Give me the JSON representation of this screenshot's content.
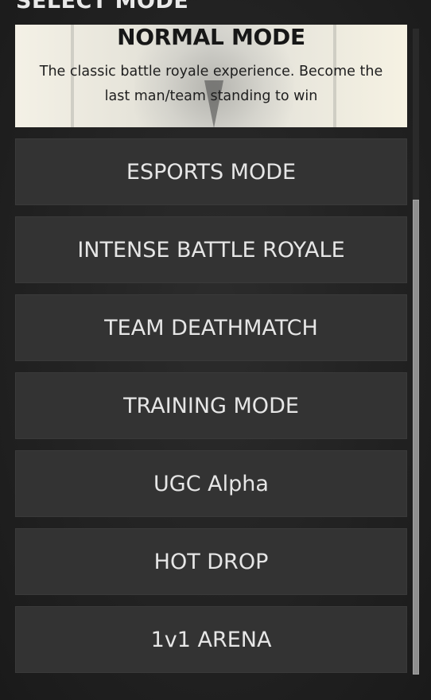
{
  "panel": {
    "title": "SELECT MODE"
  },
  "featured_mode": {
    "title": "NORMAL MODE",
    "description": "The classic battle royale experience. Become the last man/team standing to win"
  },
  "modes": [
    {
      "label": "ESPORTS MODE"
    },
    {
      "label": "INTENSE BATTLE ROYALE"
    },
    {
      "label": "TEAM DEATHMATCH"
    },
    {
      "label": "TRAINING MODE"
    },
    {
      "label": "UGC Alpha"
    },
    {
      "label": "HOT DROP"
    },
    {
      "label": "1v1 ARENA"
    }
  ],
  "colors": {
    "background": "#242424",
    "button": "#333333",
    "text": "#e6e6e6",
    "scroll_thumb": "#8f8f8f"
  }
}
